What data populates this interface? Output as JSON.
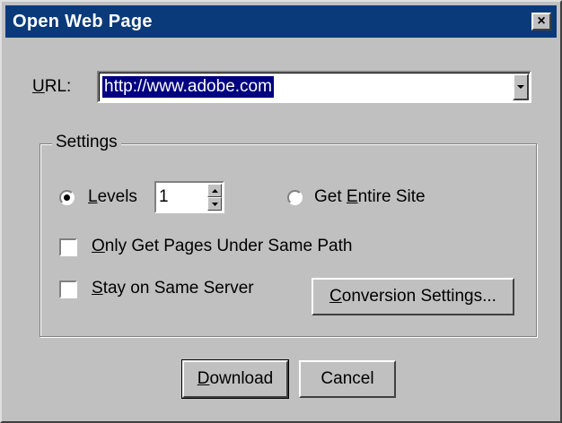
{
  "window": {
    "title": "Open Web Page",
    "close_glyph": "×"
  },
  "url": {
    "label_accel": "U",
    "label_rest": "RL:",
    "value": "http://www.adobe.com"
  },
  "settings": {
    "group_label": "Settings",
    "levels": {
      "label_accel": "L",
      "label_rest": "evels",
      "value": "1",
      "selected": true
    },
    "entire_site": {
      "label_pre": "Get ",
      "label_accel": "E",
      "label_rest": "ntire Site",
      "selected": false
    },
    "same_path": {
      "label_accel": "O",
      "label_rest": "nly Get Pages Under Same Path",
      "checked": false
    },
    "same_server": {
      "label_accel": "S",
      "label_rest": "tay on Same Server",
      "checked": false
    },
    "conversion_button": {
      "label_accel": "C",
      "label_rest": "onversion Settings..."
    }
  },
  "footer": {
    "download": {
      "label_accel": "D",
      "label_rest": "ownload"
    },
    "cancel": {
      "label": "Cancel"
    }
  },
  "colors": {
    "titlebar": "#0a3a7a",
    "dialog_bg": "#c0c0c0",
    "selection": "#000080"
  },
  "icons": [
    "close-icon",
    "dropdown-arrow-icon",
    "spin-up-icon",
    "spin-down-icon"
  ]
}
